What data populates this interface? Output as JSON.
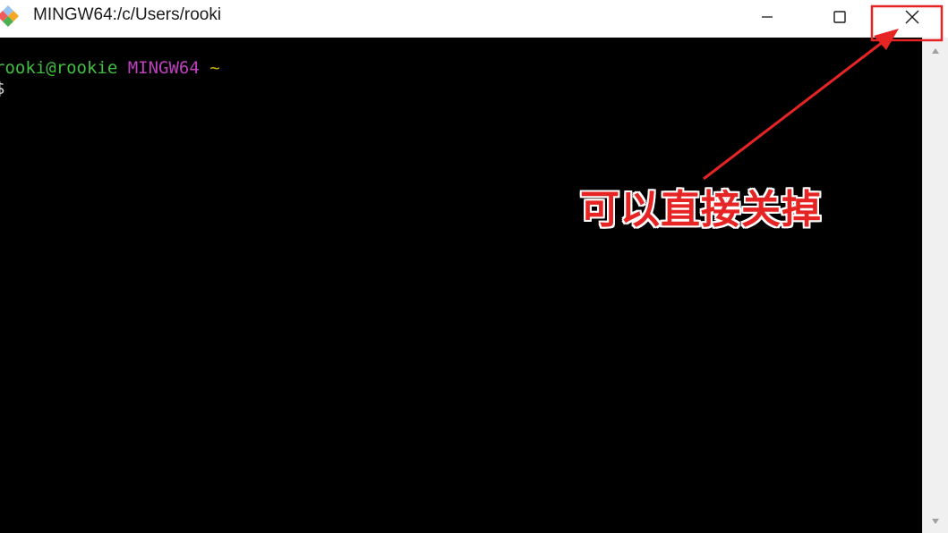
{
  "window": {
    "title": "MINGW64:/c/Users/rooki",
    "app_icon": "git-diamond-icon"
  },
  "title_buttons": {
    "minimize_icon": "minimize-icon",
    "maximize_icon": "maximize-icon",
    "close_icon": "close-icon"
  },
  "terminal": {
    "prompt_user": "rooki@rookie",
    "prompt_host": "MINGW64",
    "prompt_path": "~",
    "input_line": "$"
  },
  "annotation": {
    "text": "可以直接关掉",
    "color": "#e62424"
  },
  "colors": {
    "user": "#3fbf3f",
    "host": "#bf3fbf",
    "path": "#c8b400",
    "highlight": "#e62424"
  }
}
